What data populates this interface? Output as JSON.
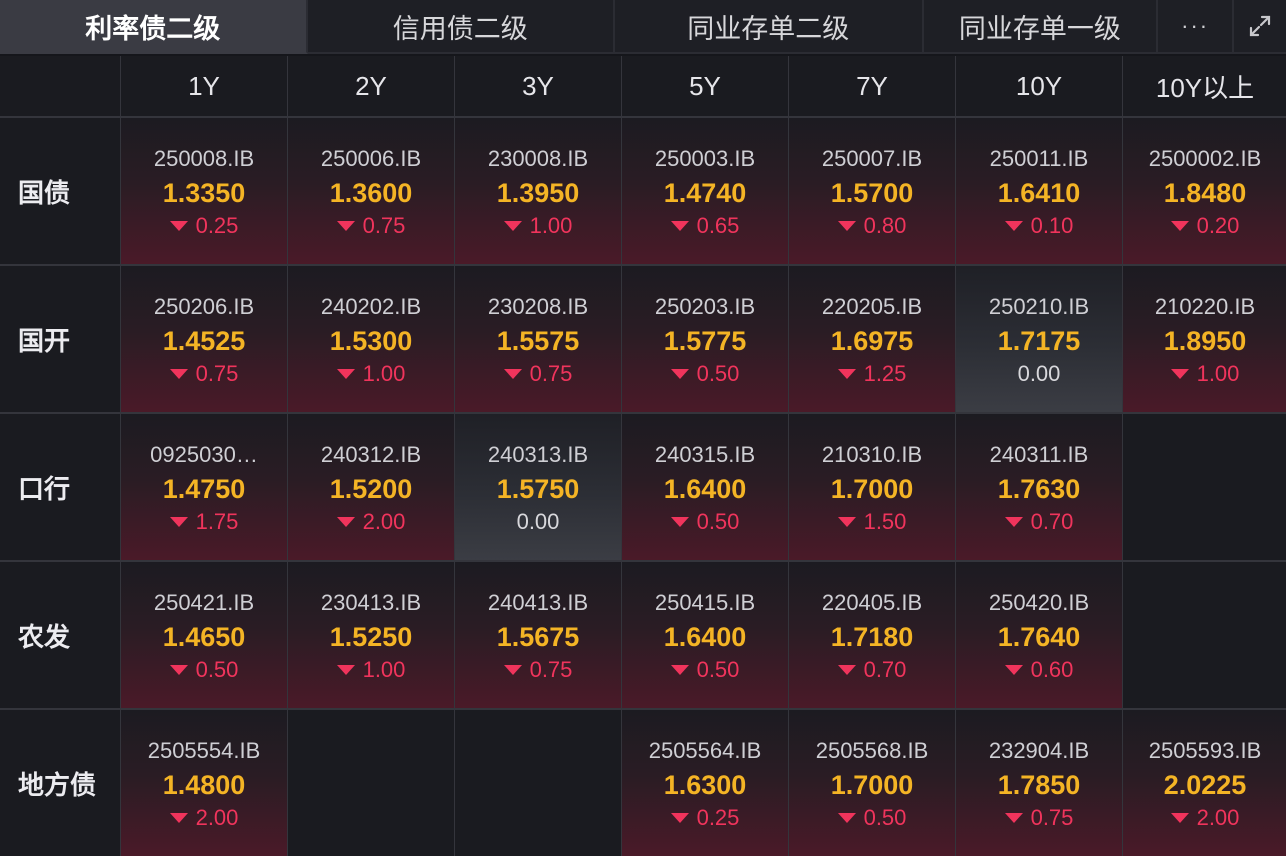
{
  "tabs": [
    "利率债二级",
    "信用债二级",
    "同业存单二级",
    "同业存单一级"
  ],
  "more_label": "···",
  "columns": [
    "1Y",
    "2Y",
    "3Y",
    "5Y",
    "7Y",
    "10Y",
    "10Y以上"
  ],
  "rows": [
    {
      "label": "国债",
      "cells": [
        {
          "code": "250008.IB",
          "rate": "1.3350",
          "change": "0.25",
          "dir": "down"
        },
        {
          "code": "250006.IB",
          "rate": "1.3600",
          "change": "0.75",
          "dir": "down"
        },
        {
          "code": "230008.IB",
          "rate": "1.3950",
          "change": "1.00",
          "dir": "down"
        },
        {
          "code": "250003.IB",
          "rate": "1.4740",
          "change": "0.65",
          "dir": "down"
        },
        {
          "code": "250007.IB",
          "rate": "1.5700",
          "change": "0.80",
          "dir": "down"
        },
        {
          "code": "250011.IB",
          "rate": "1.6410",
          "change": "0.10",
          "dir": "down"
        },
        {
          "code": "2500002.IB",
          "rate": "1.8480",
          "change": "0.20",
          "dir": "down"
        }
      ]
    },
    {
      "label": "国开",
      "cells": [
        {
          "code": "250206.IB",
          "rate": "1.4525",
          "change": "0.75",
          "dir": "down"
        },
        {
          "code": "240202.IB",
          "rate": "1.5300",
          "change": "1.00",
          "dir": "down"
        },
        {
          "code": "230208.IB",
          "rate": "1.5575",
          "change": "0.75",
          "dir": "down"
        },
        {
          "code": "250203.IB",
          "rate": "1.5775",
          "change": "0.50",
          "dir": "down"
        },
        {
          "code": "220205.IB",
          "rate": "1.6975",
          "change": "1.25",
          "dir": "down"
        },
        {
          "code": "250210.IB",
          "rate": "1.7175",
          "change": "0.00",
          "dir": "flat"
        },
        {
          "code": "210220.IB",
          "rate": "1.8950",
          "change": "1.00",
          "dir": "down"
        }
      ]
    },
    {
      "label": "口行",
      "cells": [
        {
          "code": "0925030…",
          "rate": "1.4750",
          "change": "1.75",
          "dir": "down"
        },
        {
          "code": "240312.IB",
          "rate": "1.5200",
          "change": "2.00",
          "dir": "down"
        },
        {
          "code": "240313.IB",
          "rate": "1.5750",
          "change": "0.00",
          "dir": "flat"
        },
        {
          "code": "240315.IB",
          "rate": "1.6400",
          "change": "0.50",
          "dir": "down"
        },
        {
          "code": "210310.IB",
          "rate": "1.7000",
          "change": "1.50",
          "dir": "down"
        },
        {
          "code": "240311.IB",
          "rate": "1.7630",
          "change": "0.70",
          "dir": "down"
        },
        null
      ]
    },
    {
      "label": "农发",
      "cells": [
        {
          "code": "250421.IB",
          "rate": "1.4650",
          "change": "0.50",
          "dir": "down"
        },
        {
          "code": "230413.IB",
          "rate": "1.5250",
          "change": "1.00",
          "dir": "down"
        },
        {
          "code": "240413.IB",
          "rate": "1.5675",
          "change": "0.75",
          "dir": "down"
        },
        {
          "code": "250415.IB",
          "rate": "1.6400",
          "change": "0.50",
          "dir": "down"
        },
        {
          "code": "220405.IB",
          "rate": "1.7180",
          "change": "0.70",
          "dir": "down"
        },
        {
          "code": "250420.IB",
          "rate": "1.7640",
          "change": "0.60",
          "dir": "down"
        },
        null
      ]
    },
    {
      "label": "地方债",
      "cells": [
        {
          "code": "2505554.IB",
          "rate": "1.4800",
          "change": "2.00",
          "dir": "down"
        },
        null,
        null,
        {
          "code": "2505564.IB",
          "rate": "1.6300",
          "change": "0.25",
          "dir": "down"
        },
        {
          "code": "2505568.IB",
          "rate": "1.7000",
          "change": "0.50",
          "dir": "down"
        },
        {
          "code": "232904.IB",
          "rate": "1.7850",
          "change": "0.75",
          "dir": "down"
        },
        {
          "code": "2505593.IB",
          "rate": "2.0225",
          "change": "2.00",
          "dir": "down"
        }
      ]
    }
  ],
  "colors": {
    "rate": "#f4b425",
    "down": "#f0345c",
    "flat": "#d8d8dc",
    "active_tab": "#3a3b43"
  }
}
